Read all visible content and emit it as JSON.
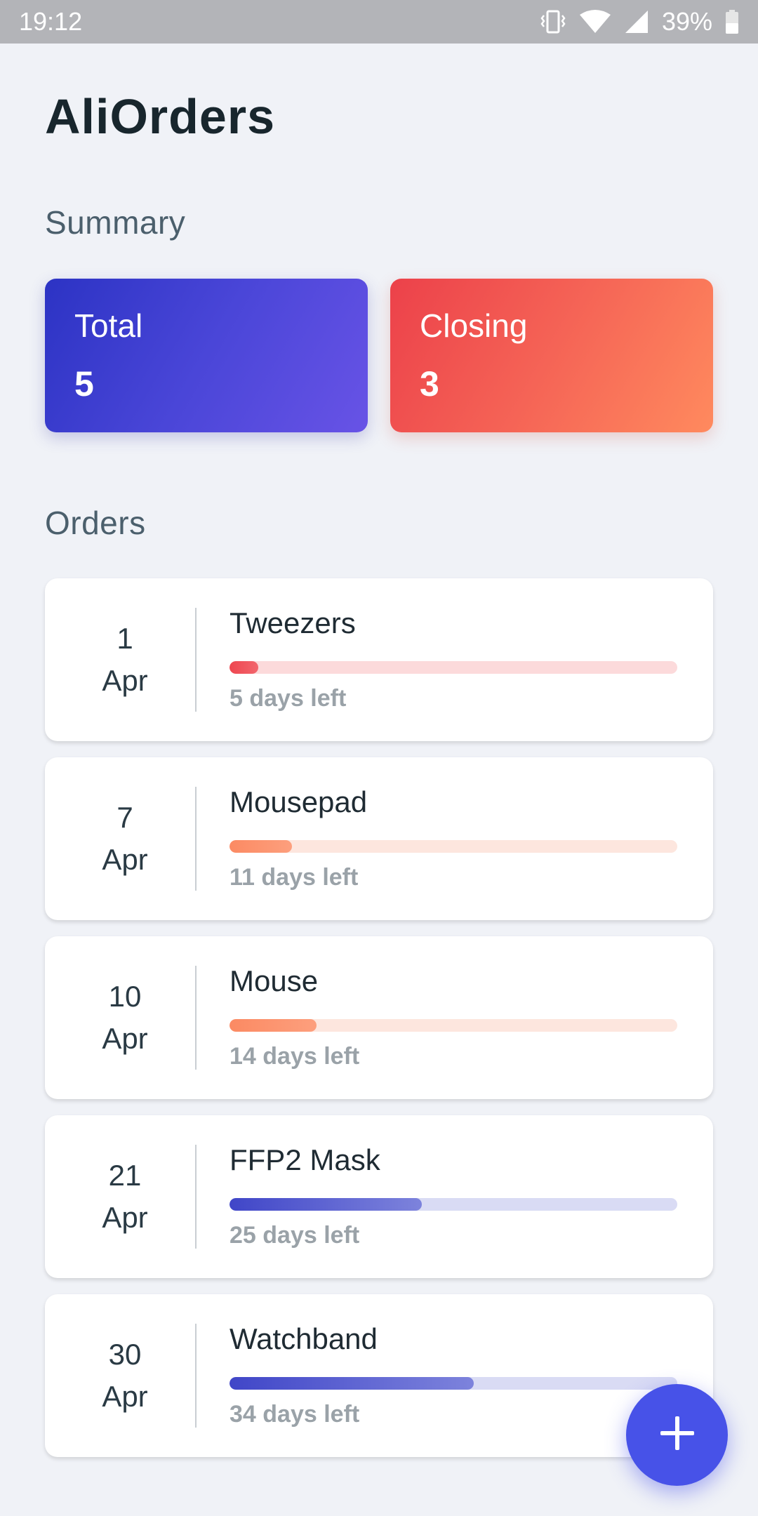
{
  "status_bar": {
    "time": "19:12",
    "battery": "39%",
    "icons": [
      "vibrate-icon",
      "wifi-icon",
      "signal-icon",
      "battery-icon"
    ]
  },
  "app": {
    "title": "AliOrders"
  },
  "summary": {
    "title": "Summary",
    "total": {
      "label": "Total",
      "value": "5"
    },
    "closing": {
      "label": "Closing",
      "value": "3"
    }
  },
  "orders": {
    "title": "Orders",
    "items": [
      {
        "day": "1",
        "month": "Apr",
        "name": "Tweezers",
        "left": "5 days left",
        "progress": 0.065,
        "fill": "#ee4650",
        "fill_end": "#f2666d",
        "track": "#fcdadb"
      },
      {
        "day": "7",
        "month": "Apr",
        "name": "Mousepad",
        "left": "11 days left",
        "progress": 0.14,
        "fill": "#fb8a63",
        "fill_end": "#fd9f7d",
        "track": "#fde6de"
      },
      {
        "day": "10",
        "month": "Apr",
        "name": "Mouse",
        "left": "14 days left",
        "progress": 0.195,
        "fill": "#fb8a63",
        "fill_end": "#fd9f7d",
        "track": "#fde6de"
      },
      {
        "day": "21",
        "month": "Apr",
        "name": "FFP2 Mask",
        "left": "25 days left",
        "progress": 0.43,
        "fill": "#4046c8",
        "fill_end": "#7d83dc",
        "track": "#d9dbf4"
      },
      {
        "day": "30",
        "month": "Apr",
        "name": "Watchband",
        "left": "34 days left",
        "progress": 0.545,
        "fill": "#4046c8",
        "fill_end": "#7d83dc",
        "track": "#d9dbf4"
      }
    ]
  },
  "fab": {
    "icon": "plus-icon",
    "color": "#4752e8"
  }
}
